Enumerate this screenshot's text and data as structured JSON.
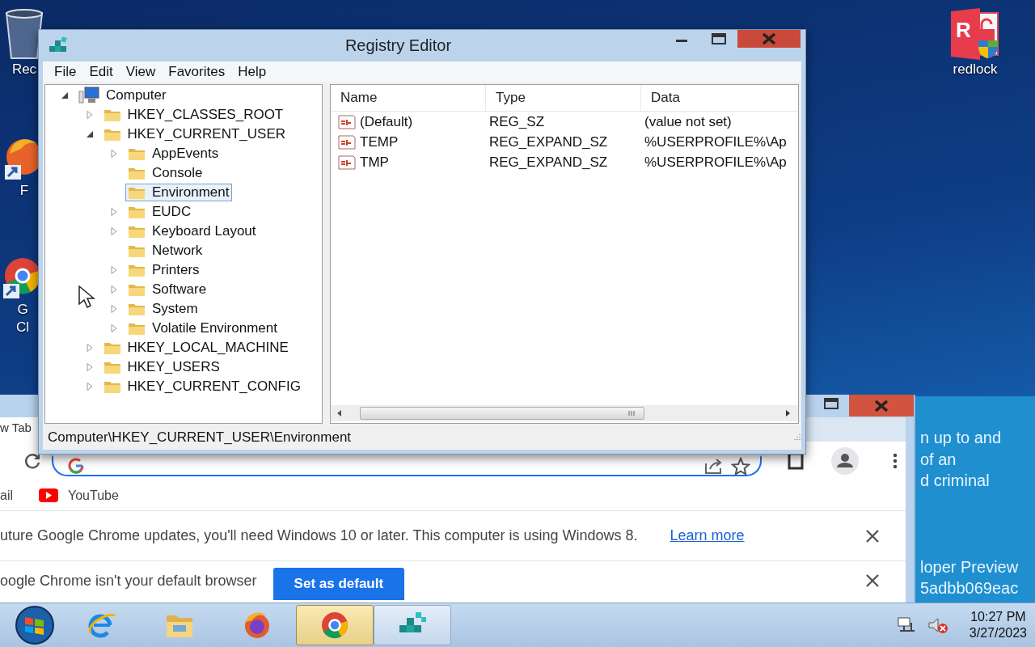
{
  "desktop_icons": [
    {
      "kind": "recycle_bin",
      "lines": [
        "Rec"
      ]
    },
    {
      "kind": "firefox",
      "lines": [
        "F"
      ]
    },
    {
      "kind": "chrome",
      "lines": [
        "G",
        "Cl"
      ]
    },
    {
      "kind": "redlock",
      "logo_letter": "R",
      "lines": [
        "redlock"
      ]
    }
  ],
  "note_window": {
    "paragraphs": [
      [
        "n up to and",
        "of an",
        "d criminal"
      ],
      [
        "loper Preview",
        "5adbb069eac"
      ]
    ]
  },
  "browser": {
    "tab_title": "w Tab",
    "bookmarks": [
      {
        "kind": "plain",
        "label": "ail"
      },
      {
        "kind": "youtube",
        "label": "YouTube"
      }
    ],
    "infobars": [
      {
        "kind": "link",
        "text": "uture Google Chrome updates, you'll need Windows 10 or later. This computer is using Windows 8.",
        "action": "Learn more"
      },
      {
        "kind": "button",
        "text": "oogle Chrome isn't your default browser",
        "action": "Set as default"
      }
    ]
  },
  "registry_editor": {
    "title": "Registry Editor",
    "menu": [
      "File",
      "Edit",
      "View",
      "Favorites",
      "Help"
    ],
    "tree": [
      {
        "label": "Computer",
        "expanded": true,
        "selected": false,
        "children": [
          {
            "label": "HKEY_CLASSES_ROOT",
            "expanded": false,
            "selected": false
          },
          {
            "label": "HKEY_CURRENT_USER",
            "expanded": true,
            "selected": false,
            "children": [
              {
                "label": "AppEvents",
                "expanded": false,
                "selected": false
              },
              {
                "label": "Console",
                "selected": false
              },
              {
                "label": "Environment",
                "selected": true
              },
              {
                "label": "EUDC",
                "expanded": false,
                "selected": false
              },
              {
                "label": "Keyboard Layout",
                "expanded": false,
                "selected": false
              },
              {
                "label": "Network",
                "selected": false
              },
              {
                "label": "Printers",
                "expanded": false,
                "selected": false
              },
              {
                "label": "Software",
                "expanded": false,
                "selected": false
              },
              {
                "label": "System",
                "expanded": false,
                "selected": false
              },
              {
                "label": "Volatile Environment",
                "expanded": false,
                "selected": false
              }
            ]
          },
          {
            "label": "HKEY_LOCAL_MACHINE",
            "expanded": false,
            "selected": false
          },
          {
            "label": "HKEY_USERS",
            "expanded": false,
            "selected": false
          },
          {
            "label": "HKEY_CURRENT_CONFIG",
            "expanded": false,
            "selected": false
          }
        ]
      }
    ],
    "columns": [
      "Name",
      "Type",
      "Data"
    ],
    "rows": [
      {
        "name": "(Default)",
        "type": "REG_SZ",
        "data": "(value not set)"
      },
      {
        "name": "TEMP",
        "type": "REG_EXPAND_SZ",
        "data": "%USERPROFILE%\\Ap"
      },
      {
        "name": "TMP",
        "type": "REG_EXPAND_SZ",
        "data": "%USERPROFILE%\\Ap"
      }
    ],
    "status": "Computer\\HKEY_CURRENT_USER\\Environment"
  },
  "taskbar": {
    "apps": [
      {
        "kind": "ie",
        "selected": false
      },
      {
        "kind": "explorer",
        "selected": false
      },
      {
        "kind": "firefox",
        "selected": false
      },
      {
        "kind": "chrome",
        "selected": true
      },
      {
        "kind": "regedit",
        "selected": false
      }
    ],
    "time": "10:27 PM",
    "date": "3/27/2023"
  }
}
